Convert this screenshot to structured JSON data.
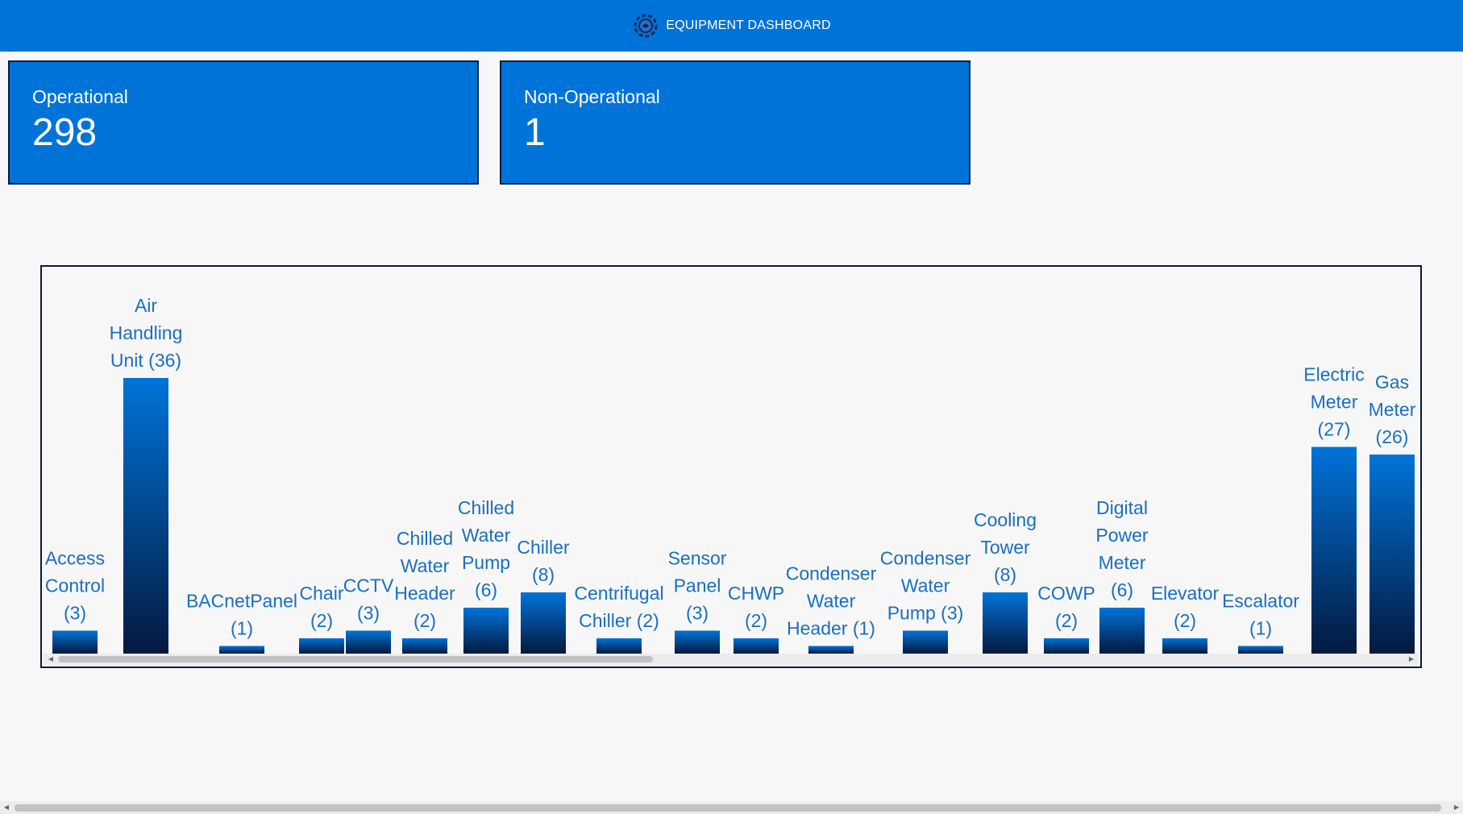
{
  "header": {
    "title": "EQUIPMENT DASHBOARD",
    "logo_icon": "gear-network-icon",
    "background": "#0073d8"
  },
  "cards": [
    {
      "label": "Operational",
      "value": "298"
    },
    {
      "label": "Non-Operational",
      "value": "1"
    }
  ],
  "chart_data": {
    "type": "bar",
    "title": "",
    "xlabel": "",
    "ylabel": "",
    "categories": [
      "Access Control (3)",
      "Air Handling Unit (36)",
      "BACnetPanel (1)",
      "Chair (2)",
      "CCTV (3)",
      "Chilled Water Header (2)",
      "Chilled Water Pump (6)",
      "Chiller (8)",
      "Centrifugal Chiller (2)",
      "Sensor Panel (3)",
      "CHWP (2)",
      "Condenser Water Header (1)",
      "Condenser Water Pump (3)",
      "Cooling Tower (8)",
      "COWP (2)",
      "Digital Power Meter (6)",
      "Elevator (2)",
      "Escalator (1)",
      "Electric Meter (27)",
      "Gas Meter (26)"
    ],
    "values": [
      3,
      36,
      1,
      2,
      3,
      2,
      6,
      8,
      2,
      3,
      2,
      1,
      3,
      8,
      2,
      6,
      2,
      1,
      27,
      26
    ],
    "bar_gradient": [
      "#0073d8",
      "#04193f"
    ],
    "label_color": "#1a6fc0",
    "grid": false,
    "legend": "none"
  }
}
